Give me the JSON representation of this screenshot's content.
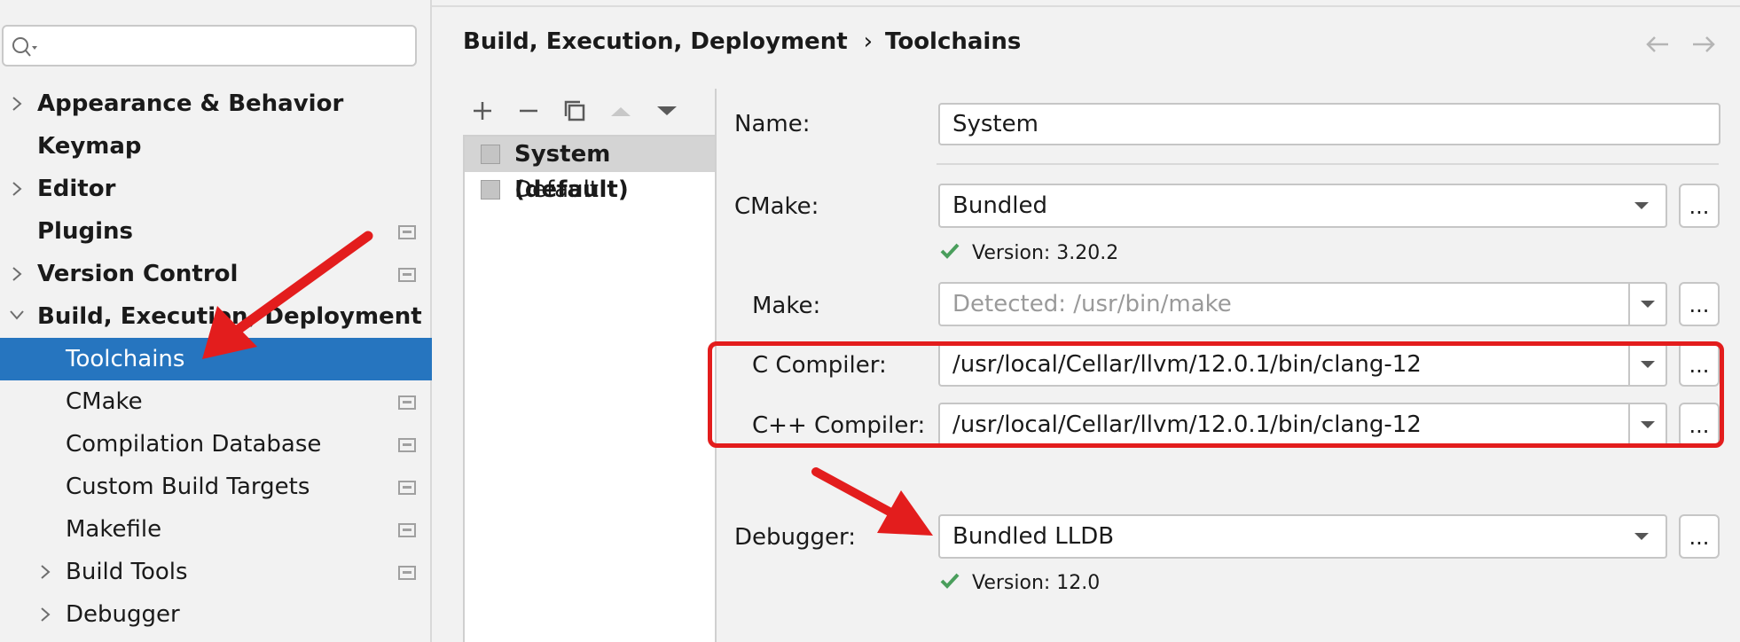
{
  "sidebar": {
    "search": {
      "placeholder": "",
      "value": ""
    },
    "items": [
      {
        "label": "Appearance & Behavior",
        "expandable": true
      },
      {
        "label": "Keymap"
      },
      {
        "label": "Editor",
        "expandable": true
      },
      {
        "label": "Plugins",
        "project_icon": "project-settings-icon"
      },
      {
        "label": "Version Control",
        "expandable": true,
        "project_icon": "project-settings-icon"
      },
      {
        "label": "Build, Execution, Deployment",
        "expanded": true
      },
      {
        "label": "Toolchains",
        "selected": true
      },
      {
        "label": "CMake",
        "project_icon": "project-settings-icon"
      },
      {
        "label": "Compilation Database",
        "project_icon": "project-settings-icon"
      },
      {
        "label": "Custom Build Targets",
        "project_icon": "project-settings-icon"
      },
      {
        "label": "Makefile",
        "project_icon": "project-settings-icon"
      },
      {
        "label": "Build Tools",
        "expandable": true,
        "project_icon": "project-settings-icon"
      },
      {
        "label": "Debugger",
        "expandable": true
      }
    ]
  },
  "header": {
    "breadcrumb": [
      "Build, Execution, Deployment",
      "Toolchains"
    ],
    "separator": "›"
  },
  "toolchains": {
    "toolbar_icons": [
      "add-icon",
      "remove-icon",
      "copy-icon",
      "move-up-icon",
      "move-down-icon"
    ],
    "items": [
      {
        "label": "System (default)",
        "selected": true
      },
      {
        "label": "Default"
      }
    ]
  },
  "form": {
    "name": {
      "label": "Name:",
      "value": "System"
    },
    "cmake": {
      "label": "CMake:",
      "value": "Bundled",
      "version": "Version: 3.20.2"
    },
    "make": {
      "label": "Make:",
      "placeholder": "Detected: /usr/bin/make"
    },
    "c_compiler": {
      "label": "C Compiler:",
      "value": "/usr/local/Cellar/llvm/12.0.1/bin/clang-12"
    },
    "cpp_compiler": {
      "label": "C++ Compiler:",
      "value": "/usr/local/Cellar/llvm/12.0.1/bin/clang-12"
    },
    "debugger": {
      "label": "Debugger:",
      "value": "Bundled LLDB",
      "version": "Version: 12.0"
    },
    "browse_label": "..."
  },
  "colors": {
    "selection": "#2675bf",
    "annotation_red": "#e31d1d",
    "check_green": "#4a9e5c"
  }
}
